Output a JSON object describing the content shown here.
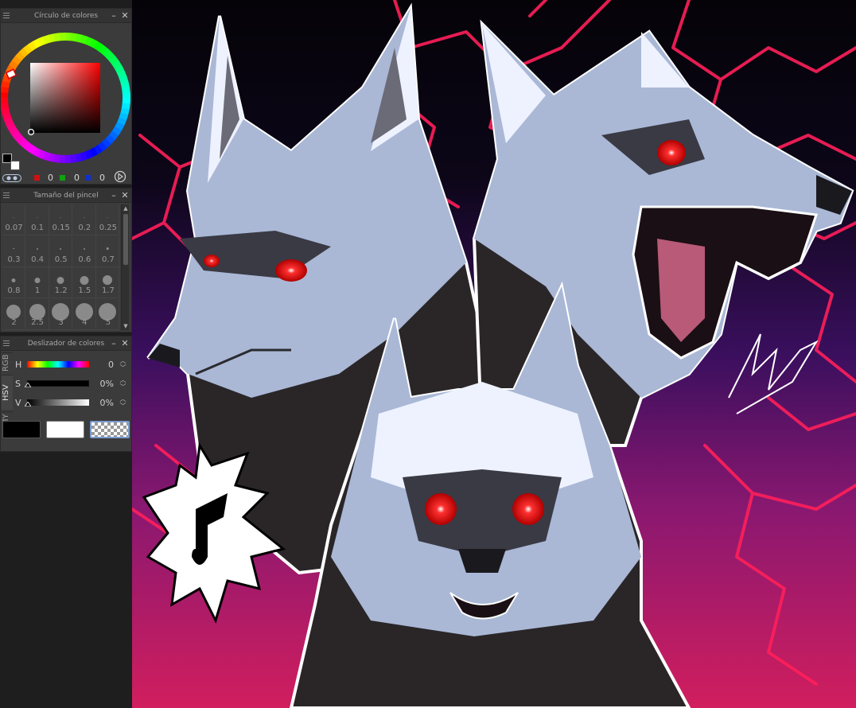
{
  "color_wheel_panel": {
    "title": "Círculo de colores",
    "rgb_values": [
      "0",
      "0",
      "0"
    ],
    "main_color": "#000000",
    "sub_color": "#ffffff",
    "wheel_hue_color": "#ff0000"
  },
  "brush_size_panel": {
    "title": "Tamaño del pincel",
    "sizes": [
      "0.07",
      "0.1",
      "0.15",
      "0.2",
      "0.25",
      "0.3",
      "0.4",
      "0.5",
      "0.6",
      "0.7",
      "0.8",
      "1",
      "1.2",
      "1.5",
      "1.7",
      "2",
      "2.5",
      "3",
      "4",
      "5"
    ]
  },
  "color_slider_panel": {
    "title": "Deslizador de colores",
    "tabs": [
      "RGB",
      "HSV",
      "CMY"
    ],
    "sliders": [
      {
        "label": "H",
        "value": "0"
      },
      {
        "label": "S",
        "value": "0%"
      },
      {
        "label": "V",
        "value": "0%"
      }
    ],
    "swatches": [
      "#000000",
      "#ffffff",
      "transparent"
    ]
  },
  "canvas": {
    "palette": {
      "bg_top": "#050308",
      "bg_mid": "#3a0f5e",
      "bg_bottom": "#d11e5e",
      "lightning": "#ff1f5a",
      "fur_light": "#aab8d6",
      "fur_white": "#eef2ff",
      "fur_dark": "#3a3a44",
      "body_dark": "#2a2628",
      "eye_red": "#ff1a1a"
    }
  }
}
